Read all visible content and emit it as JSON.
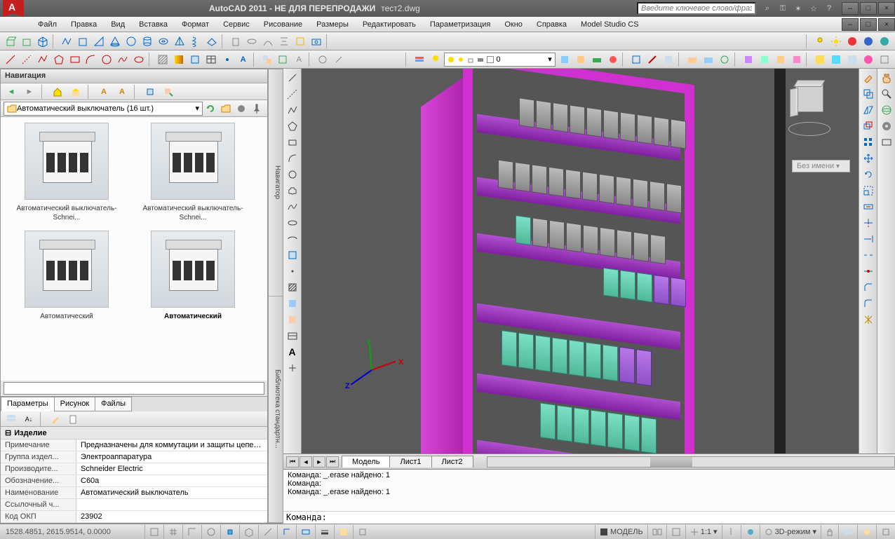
{
  "title": {
    "app": "AutoCAD 2011 - НЕ ДЛЯ ПЕРЕПРОДАЖИ",
    "file": "тест2.dwg",
    "search_placeholder": "Введите ключевое слово/фразу"
  },
  "menu": [
    "Файл",
    "Правка",
    "Вид",
    "Вставка",
    "Формат",
    "Сервис",
    "Рисование",
    "Размеры",
    "Редактировать",
    "Параметризация",
    "Окно",
    "Справка",
    "Model Studio CS"
  ],
  "layer": {
    "current": "0"
  },
  "nav": {
    "header": "Навигация",
    "folder": "Автоматический выключатель (16 шт.)",
    "items": [
      "Автоматический выключатель-Schnei...",
      "Автоматический выключатель-Schnei...",
      "Автоматический",
      "Автоматический"
    ]
  },
  "side_tabs": [
    "Навигатор",
    "Библиотека стандартн..."
  ],
  "prop": {
    "tabs": [
      "Параметры",
      "Рисунок",
      "Файлы"
    ],
    "section": "Изделие",
    "rows": [
      {
        "k": "Примечание",
        "v": "Предназначены для коммутации и  защиты цепей..."
      },
      {
        "k": "Группа издел...",
        "v": "Электроаппаратура"
      },
      {
        "k": "Производите...",
        "v": "Schneider Electric"
      },
      {
        "k": "Обозначение...",
        "v": "C60a"
      },
      {
        "k": "Наименование",
        "v": "Автоматический выключатель"
      },
      {
        "k": "Ссылочный ч...",
        "v": ""
      },
      {
        "k": "Код ОКП",
        "v": "23902"
      }
    ]
  },
  "viewcube": {
    "label": "Без имени"
  },
  "ucs": {
    "x": "X",
    "y": "Y",
    "z": "Z"
  },
  "layout_tabs": [
    "Модель",
    "Лист1",
    "Лист2"
  ],
  "cmd": {
    "lines": [
      "Команда: _.erase найдено: 1",
      "Команда:",
      "Команда: _.erase найдено: 1"
    ],
    "prompt": "Команда:"
  },
  "status": {
    "coords": "1528.4851, 2615.9514, 0.0000",
    "model": "МОДЕЛЬ",
    "scale": "1:1",
    "mode3d": "3D-режим"
  }
}
